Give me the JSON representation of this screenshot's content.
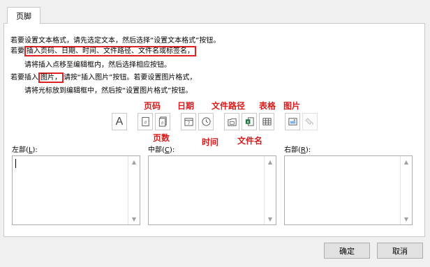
{
  "tab_label": "页脚",
  "instructions": {
    "line1": "若要设置文本格式，请先选定文本，然后选择“设置文本格式”按钮。",
    "line2_prefix": "若要",
    "line2_highlight": "插入页码、日期、时间、文件路径、文件名或标签名，",
    "line3": "请将插入点移至编辑框内，然后选择相应按钮。",
    "line4_prefix": "若要插入",
    "line4_highlight": "图片，",
    "line4_suffix": "请按“插入图片”按钮。若要设置图片格式，",
    "line5": "请将光标放到编辑框中，然后按“设置图片格式”按钮。"
  },
  "annotations": {
    "page_number": "页码",
    "page_count": "页数",
    "date": "日期",
    "time": "时间",
    "file_path": "文件路径",
    "file_name": "文件名",
    "sheet_name": "表格",
    "picture": "图片"
  },
  "toolbar_icons": [
    "format-text-icon",
    "page-number-icon",
    "page-count-icon",
    "date-icon",
    "time-icon",
    "file-path-icon",
    "file-name-icon",
    "sheet-name-icon",
    "insert-picture-icon",
    "format-picture-icon"
  ],
  "sections": {
    "left": {
      "label": "左部(",
      "key": "L",
      "close": "):"
    },
    "center": {
      "label": "中部(",
      "key": "C",
      "close": "):"
    },
    "right": {
      "label": "右部(",
      "key": "R",
      "close": "):"
    }
  },
  "buttons": {
    "ok": "确定",
    "cancel": "取消"
  },
  "colors": {
    "annotation": "#d81b1b",
    "highlight_border": "#e02020"
  }
}
